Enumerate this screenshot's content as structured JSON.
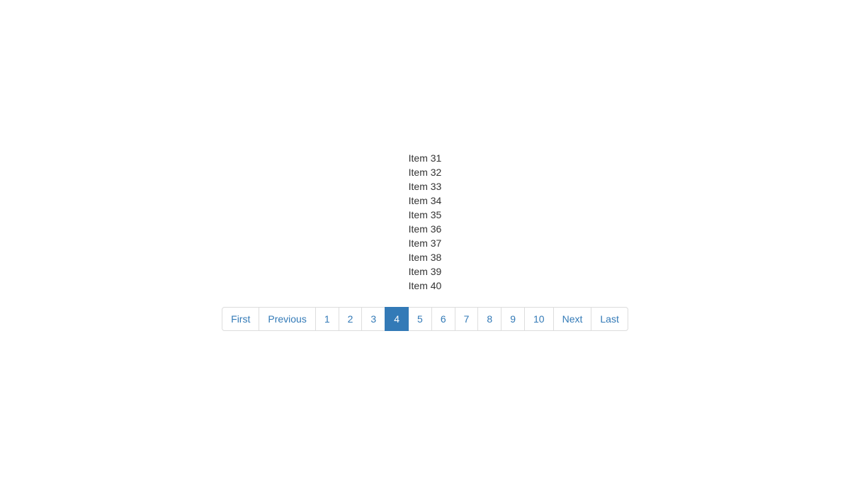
{
  "items": [
    "Item 31",
    "Item 32",
    "Item 33",
    "Item 34",
    "Item 35",
    "Item 36",
    "Item 37",
    "Item 38",
    "Item 39",
    "Item 40"
  ],
  "pagination": {
    "first": "First",
    "previous": "Previous",
    "next": "Next",
    "last": "Last",
    "pages": [
      "1",
      "2",
      "3",
      "4",
      "5",
      "6",
      "7",
      "8",
      "9",
      "10"
    ],
    "active_index": 3
  }
}
